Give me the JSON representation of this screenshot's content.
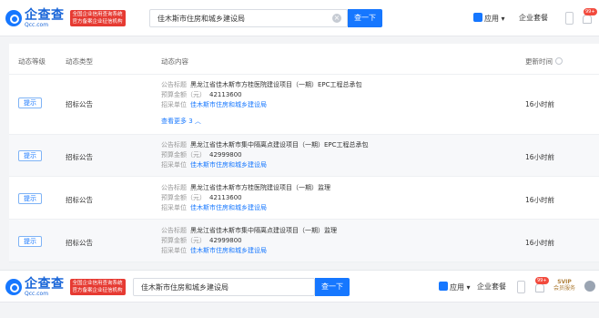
{
  "header": {
    "logo_text": "企查查",
    "logo_domain": "Qcc.com",
    "logo_badge_line1": "全国企业信用查询系统",
    "logo_badge_line2": "官方备案企业征信机构",
    "search_value": "佳木斯市住房和城乡建设局",
    "search_button": "查一下",
    "nav_app": "应用",
    "nav_enterprise": "企业套餐",
    "notif_count": "99+"
  },
  "table": {
    "columns": [
      "动态等级",
      "动态类型",
      "动态内容",
      "更新时间"
    ],
    "rows": [
      {
        "level": "提示",
        "type": "招标公告",
        "title_label": "公告标题",
        "title": "黑龙江省佳木斯市方桂医院建设项目（一期）EPC工程总承包",
        "budget_label": "预算金额（元）",
        "budget": "42113600",
        "unit_label": "招采单位",
        "unit": "佳木斯市住房和城乡建设局",
        "more": "查看更多 3 ︿",
        "time": "16小时前"
      },
      {
        "level": "提示",
        "type": "招标公告",
        "title_label": "公告标题",
        "title": "黑龙江省佳木斯市集中隔离点建设项目（一期）EPC工程总承包",
        "budget_label": "预算金额（元）",
        "budget": "42999800",
        "unit_label": "招采单位",
        "unit": "佳木斯市住房和城乡建设局",
        "time": "16小时前"
      },
      {
        "level": "提示",
        "type": "招标公告",
        "title_label": "公告标题",
        "title": "黑龙江省佳木斯市方桂医院建设项目（一期）监理",
        "budget_label": "预算金额（元）",
        "budget": "42113600",
        "unit_label": "招采单位",
        "unit": "佳木斯市住房和城乡建设局",
        "time": "16小时前"
      },
      {
        "level": "提示",
        "type": "招标公告",
        "title_label": "公告标题",
        "title": "黑龙江省佳木斯市集中隔离点建设项目（一期）监理",
        "budget_label": "预算金额（元）",
        "budget": "42999800",
        "unit_label": "招采单位",
        "unit": "佳木斯市住房和城乡建设局",
        "time": "16小时前"
      }
    ]
  },
  "bottom_header": {
    "logo_text": "企查查",
    "logo_domain": "Qcc.com",
    "logo_badge_line1": "全国企业信用查询系统",
    "logo_badge_line2": "官方备案企业征信机构",
    "search_value": "佳木斯市住房和城乡建设局",
    "search_button": "查一下",
    "nav_app": "应用",
    "nav_enterprise": "企业套餐",
    "notif_count": "99+",
    "svip_label": "SVIP",
    "svip_sub": "会员服务"
  }
}
